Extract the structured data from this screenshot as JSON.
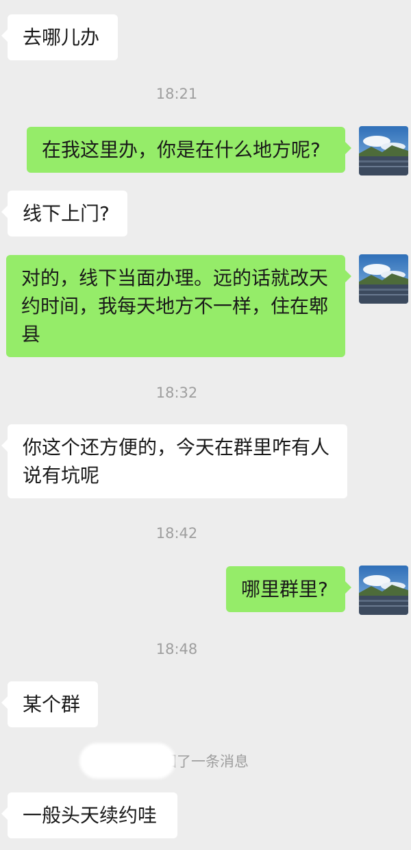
{
  "messages": [
    {
      "text": "去哪儿办"
    },
    {
      "text": "在我这里办，你是在什么地方呢?"
    },
    {
      "text": "线下上门?"
    },
    {
      "text": "对的，线下当面办理。远的话就改天\n约时间，我每天地方不一样，住在郫\n县"
    },
    {
      "text": "你这个还方便的，今天在群里咋有人\n说有坑呢"
    },
    {
      "text": "哪里群里?"
    },
    {
      "text": "某个群"
    },
    {
      "text": "一般头天续约哇"
    }
  ],
  "timestamps": [
    "18:21",
    "18:32",
    "18:42",
    "18:48"
  ],
  "recall_notice": "回了一条消息",
  "avatar": {
    "type": "landscape-photo",
    "sky": "#4a86c8",
    "water": "#3c4a5e"
  }
}
